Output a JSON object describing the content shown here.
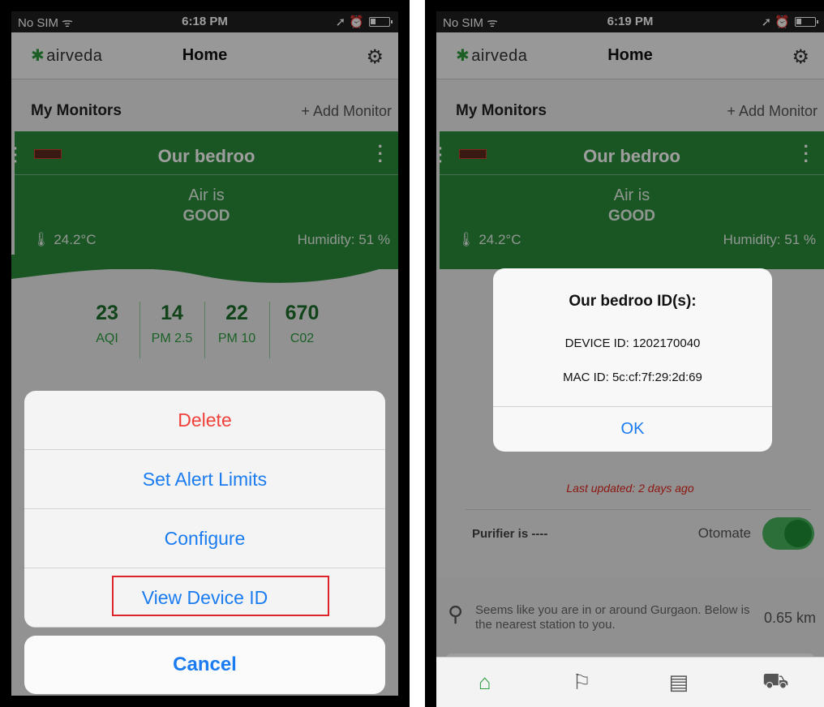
{
  "left": {
    "status": {
      "carrier": "No SIM ᯤ",
      "time": "6:18 PM",
      "icons": "➚ ⏰"
    },
    "nav": {
      "brand": "airveda",
      "title": "Home",
      "settings_icon": "gear-icon"
    },
    "section": {
      "title": "My Monitors",
      "add": "+ Add Monitor"
    },
    "card": {
      "name": "Our bedroo",
      "air_is": "Air is",
      "quality": "GOOD",
      "temp": "24.2°C",
      "humidity": "Humidity: 51 %"
    },
    "metrics": [
      {
        "value": "23",
        "label": "AQI"
      },
      {
        "value": "14",
        "label": "PM 2.5"
      },
      {
        "value": "22",
        "label": "PM 10"
      },
      {
        "value": "670",
        "label": "C02"
      }
    ],
    "sheet": {
      "delete": "Delete",
      "alerts": "Set Alert Limits",
      "configure": "Configure",
      "device_id": "View Device ID",
      "cancel": "Cancel"
    }
  },
  "right": {
    "status": {
      "carrier": "No SIM ᯤ",
      "time": "6:19 PM",
      "icons": "➚ ⏰"
    },
    "nav": {
      "brand": "airveda",
      "title": "Home"
    },
    "section": {
      "title": "My Monitors",
      "add": "+ Add Monitor"
    },
    "card": {
      "name": "Our bedroo",
      "air_is": "Air is",
      "quality": "GOOD",
      "temp": "24.2°C",
      "humidity": "Humidity: 51 %"
    },
    "alert": {
      "title": "Our bedroo ID(s):",
      "device": "DEVICE ID: 1202170040",
      "mac": "MAC ID: 5c:cf:7f:29:2d:69",
      "ok": "OK"
    },
    "last_updated": "Last updated: 2 days ago",
    "purifier": "Purifier is ----",
    "otomate": "Otomate",
    "location": {
      "text": "Seems like you are in or around Gurgaon. Below is the nearest station to you.",
      "distance": "0.65 km"
    }
  }
}
